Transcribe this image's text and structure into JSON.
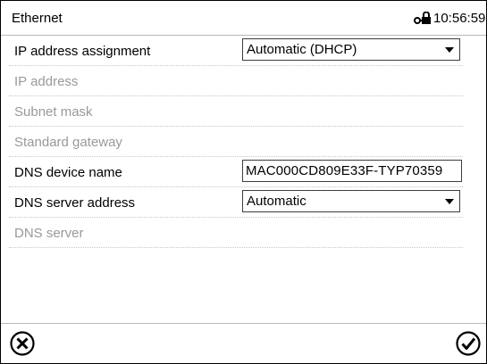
{
  "header": {
    "title": "Ethernet",
    "time": "10:56:59",
    "icon": "lock-icon"
  },
  "rows": {
    "ip_assignment": {
      "label": "IP address assignment",
      "value": "Automatic (DHCP)"
    },
    "ip_address": {
      "label": "IP address"
    },
    "subnet_mask": {
      "label": "Subnet mask"
    },
    "gateway": {
      "label": "Standard gateway"
    },
    "dns_name": {
      "label": "DNS device name",
      "value": "MAC000CD809E33F-TYP70359"
    },
    "dns_server_address": {
      "label": "DNS server  address",
      "value": "Automatic"
    },
    "dns_server": {
      "label": "DNS server"
    }
  },
  "footer": {
    "cancel_icon": "cancel-icon",
    "confirm_icon": "confirm-icon"
  },
  "colors": {
    "border": "#000000",
    "disabled_text": "#999999",
    "divider": "#b9b9b9"
  }
}
